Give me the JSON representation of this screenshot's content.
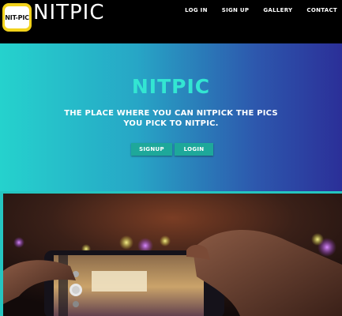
{
  "brand": {
    "logo_text": "NIT-PIC",
    "wordmark": "NITPIC"
  },
  "nav": {
    "items": [
      "LOG IN",
      "SIGN UP",
      "GALLERY",
      "CONTACT"
    ]
  },
  "hero": {
    "title": "NITPIC",
    "subtitle": "THE PLACE WHERE YOU CAN NITPICK THE PICS YOU PICK TO NITPIC.",
    "signup_label": "SIGNUP",
    "login_label": "LOGIN"
  },
  "colors": {
    "accent": "#33e6d2",
    "button": "#1ea89a",
    "logo_yellow": "#f2d21b"
  }
}
